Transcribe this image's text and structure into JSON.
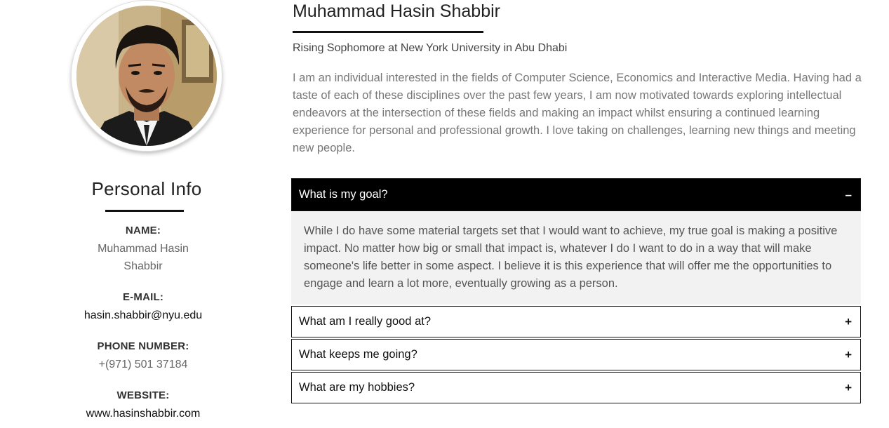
{
  "profile": {
    "name": "Muhammad Hasin Shabbir",
    "subtitle": "Rising Sophomore at New York University in Abu Dhabi",
    "bio": "I am an individual interested in the fields of Computer Science, Economics and Interactive Media. Having had a taste of each of these disciplines over the past few years, I am now motivated towards exploring intellectual endeavors at the intersection of these fields and making an impact whilst ensuring a continued learning experience for personal and professional growth. I love taking on challenges, learning new things and meeting new people."
  },
  "personal_info": {
    "title": "Personal Info",
    "name_label": "NAME:",
    "name_value_line1": "Muhammad Hasin",
    "name_value_line2": "Shabbir",
    "email_label": "E-MAIL:",
    "email_value": "hasin.shabbir@nyu.edu",
    "phone_label": "PHONE NUMBER:",
    "phone_value": "+(971) 501 37184",
    "website_label": "WEBSITE:",
    "website_value": "www.hasinshabbir.com"
  },
  "accordion": {
    "items": [
      {
        "question": "What is my goal?",
        "sign": "–",
        "open": true,
        "answer": "While I do have some material targets set that I would want to achieve, my true goal is making a positive impact. No matter how big or small that impact is, whatever I do I want to do in a way that will make someone's life better in some aspect. I believe it is this experience that will offer me the opportunities to engage and learn a lot more, eventually growing as a person."
      },
      {
        "question": "What am I really good at?",
        "sign": "+",
        "open": false
      },
      {
        "question": "What keeps me going?",
        "sign": "+",
        "open": false
      },
      {
        "question": "What are my hobbies?",
        "sign": "+",
        "open": false
      }
    ]
  },
  "colors": {
    "accent": "#000000",
    "panel": "#f2f2f2",
    "muted_text": "#777777"
  },
  "icons": {
    "photo": "profile-photo",
    "open": "minus-icon",
    "closed": "plus-icon"
  }
}
